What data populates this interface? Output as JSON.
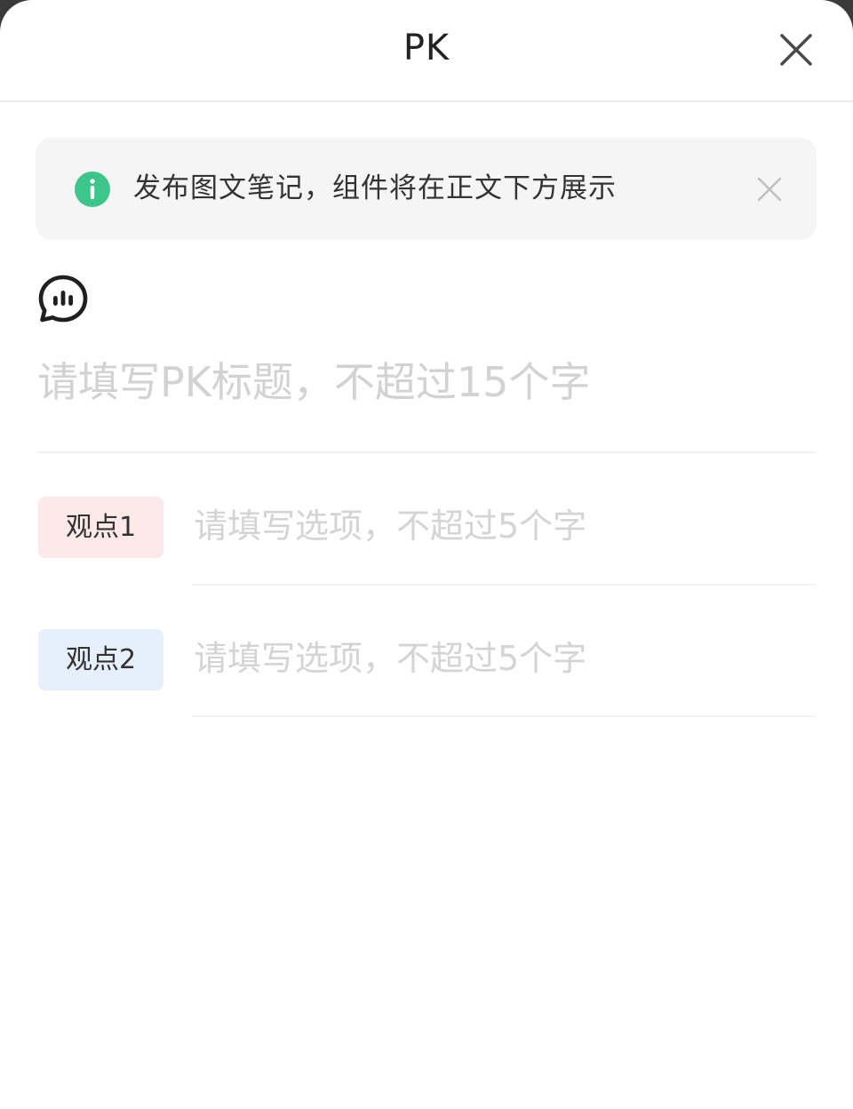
{
  "header": {
    "title": "PK",
    "close_icon": "close-icon"
  },
  "notice": {
    "icon": "info-icon",
    "icon_color": "#3ec58c",
    "text": "发布图文笔记，组件将在正文下方展示",
    "close_icon": "close-icon"
  },
  "poll": {
    "icon": "chat-bubble-chart-icon",
    "title_placeholder": "请填写PK标题，不超过15个字"
  },
  "options": [
    {
      "label": "观点1",
      "color": "#fde9e7",
      "placeholder": "请填写选项，不超过5个字"
    },
    {
      "label": "观点2",
      "color": "#e6effc",
      "placeholder": "请填写选项，不超过5个字"
    }
  ]
}
